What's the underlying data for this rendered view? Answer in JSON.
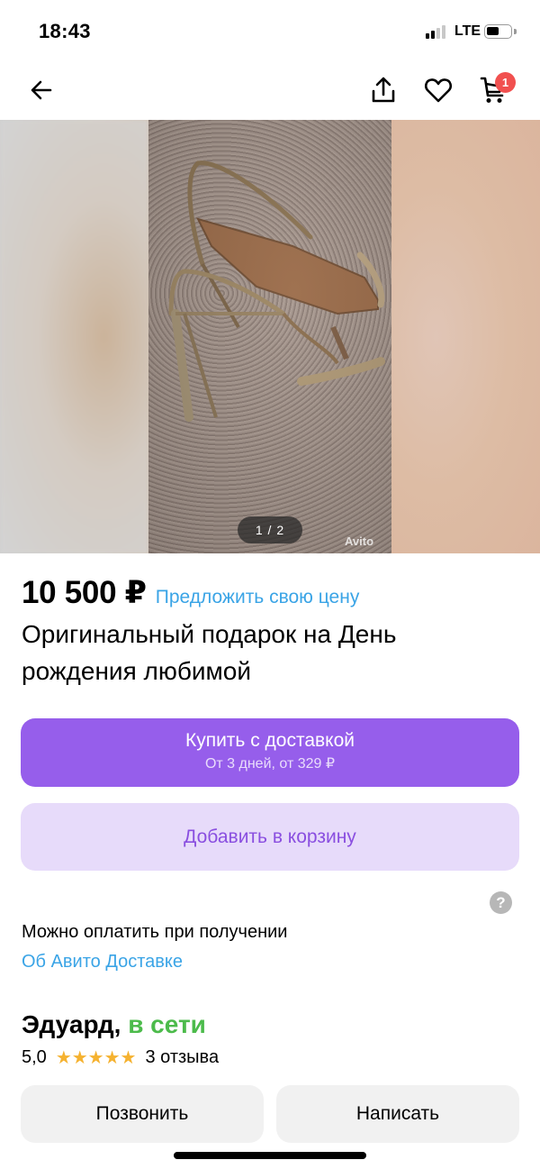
{
  "status_bar": {
    "time": "18:43",
    "network": "LTE",
    "icons": [
      "signal-icon",
      "battery-icon"
    ]
  },
  "nav": {
    "icons": [
      "back-arrow-icon",
      "share-icon",
      "heart-icon",
      "cart-icon"
    ],
    "cart_count": "1"
  },
  "gallery": {
    "counter": "1 / 2",
    "watermark": "Avito"
  },
  "listing": {
    "price": "10 500 ₽",
    "offer_link": "Предложить свою цену",
    "title": "Оригинальный подарок на День рождения любимой"
  },
  "actions": {
    "buy_label": "Купить с доставкой",
    "buy_sublabel": "От 3 дней, от 329 ₽",
    "cart_label": "Добавить в корзину"
  },
  "delivery": {
    "help_icon": "question-icon",
    "pay_note": "Можно оплатить при получении",
    "about_link": "Об Авито Доставке"
  },
  "seller": {
    "name": "Эдуард,",
    "status": "в сети",
    "rating": "5,0",
    "stars": "★★★★★",
    "reviews": "3 отзыва"
  },
  "contact": {
    "call_label": "Позвонить",
    "write_label": "Написать"
  },
  "colors": {
    "accent_purple": "#965eeb",
    "secondary_purple_bg": "#e7dbfa",
    "link_blue": "#3aa4e6",
    "online_green": "#4cbb4b",
    "badge_red": "#f1504f",
    "star_yellow": "#f5b230"
  }
}
